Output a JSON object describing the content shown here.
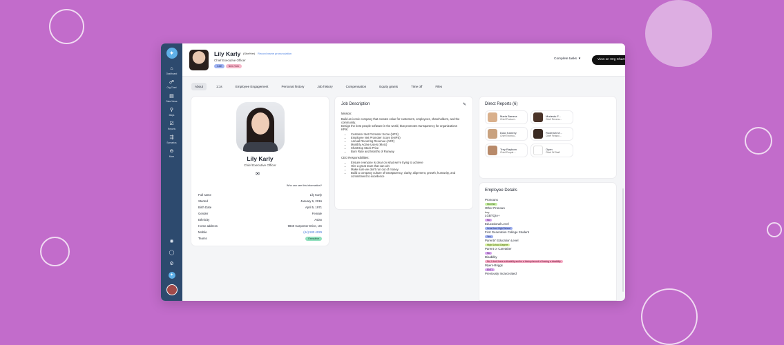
{
  "colors": {
    "background": "#c26ccb",
    "rail": "#2d4a6e",
    "primary_button": "#111111",
    "link": "#3a70d8"
  },
  "rail": {
    "items": [
      {
        "icon": "home-icon",
        "glyph": "⌂",
        "label": "Dashboard"
      },
      {
        "icon": "org-chart-icon",
        "glyph": "☍",
        "label": "Org Chart"
      },
      {
        "icon": "document-icon",
        "glyph": "▤",
        "label": "Data Views"
      },
      {
        "icon": "map-pin-icon",
        "glyph": "⚲",
        "label": "Maps"
      },
      {
        "icon": "reports-icon",
        "glyph": "☑",
        "label": "Reports"
      },
      {
        "icon": "scenarios-icon",
        "glyph": "⇶",
        "label": "Scenarios"
      },
      {
        "icon": "more-icon",
        "glyph": "⊖",
        "label": "More"
      }
    ],
    "bottom_icons": [
      {
        "icon": "settings-sun-icon",
        "glyph": "✺"
      },
      {
        "icon": "chat-icon",
        "glyph": "◯"
      },
      {
        "icon": "gear-icon",
        "glyph": "⚙"
      }
    ]
  },
  "header": {
    "name": "Lily Karly",
    "pronouns": "(She/Her)",
    "record_link": "Record name pronunciation",
    "title": "Chief Executive Officer",
    "chips": [
      "C&E",
      "New York"
    ],
    "complete_tasks": "Complete tasks",
    "org_button": "View on Org Chart"
  },
  "tabs": [
    "About",
    "1:1s",
    "Employee Engagement",
    "Personal history",
    "Job history",
    "Compensation",
    "Equity grants",
    "Time off",
    "Files"
  ],
  "profile": {
    "name": "Lily Karly",
    "title": "Chief Executive Officer",
    "visibility": "Who can see this information?",
    "fields": [
      {
        "label": "Full name",
        "value": "Lily Karly"
      },
      {
        "label": "Started",
        "value": "January 6, 2016"
      },
      {
        "label": "Birth Date",
        "value": "April 5, 1971"
      },
      {
        "label": "Gender",
        "value": "Female"
      },
      {
        "label": "Ethnicity",
        "value": "Asian"
      },
      {
        "label": "Home address",
        "value": "9840 Carpenter Drive, US"
      },
      {
        "label": "Mobile",
        "value": "(44) 500 4029"
      },
      {
        "label": "Teams",
        "value": "Executive"
      }
    ]
  },
  "job_description": {
    "title": "Job Description",
    "mission_label": "Mission:",
    "mission": "Build an iconic company that creates value for customers, employees, shareholders, and the community.",
    "mission2": "Design the best people software in the world, that promotes transparency for organizations",
    "kpis_label": "KPIs:",
    "kpis": [
      "Customer Net Promoter Score (NPS)",
      "Employee Net Promoter Score (eNPS)",
      "Annual Recurring Revenue (ARR)",
      "Monthly Active Users (MAU)",
      "ChartHop Stock Price",
      "Burn Rate and Months of Runway"
    ],
    "ceo_label": "CEO Responsibilities:",
    "ceo": [
      "Ensure everyone is clear on what we're trying to achieve",
      "Hire a great team that can win",
      "Make sure we don't run out of money",
      "Build a company culture of transparency, clarity, alignment, growth, humanity, and commitment to excellence"
    ]
  },
  "direct_reports": {
    "title": "Direct Reports (6)",
    "people": [
      {
        "name": "Maria Barrera",
        "title": "Chief Product...",
        "color": "#d9b08c"
      },
      {
        "name": "Modesto F...",
        "title": "Chief Revenu...",
        "color": "#4a3328"
      },
      {
        "name": "Dulci Kamrey",
        "title": "Chief Technol...",
        "color": "#c9a27f"
      },
      {
        "name": "Roderich M...",
        "title": "Chief Financi...",
        "color": "#3a2a22"
      },
      {
        "name": "Trey Rayborn",
        "title": "Chief People ...",
        "color": "#b88a6a"
      },
      {
        "name": "Open",
        "title": "Chief Of Staff",
        "color": "#ffffff"
      }
    ]
  },
  "employee_details": {
    "title": "Employee Details",
    "items": [
      {
        "label": "Pronouns",
        "chip": "She/Her",
        "style": "lgreen"
      },
      {
        "label": "Other Pronoun",
        "text": "hey"
      },
      {
        "label": "LGBTQIA+",
        "chip": "No",
        "style": "purple"
      },
      {
        "label": "Educational Level",
        "chip": "Less than High School",
        "style": "ind"
      },
      {
        "label": "First Generation College Student",
        "chip": "Yes",
        "style": "ind"
      },
      {
        "label": "Parents' Education Level",
        "chip": "High School Degree",
        "style": "lime"
      },
      {
        "label": "Parent or Caretaker",
        "chip": "No",
        "style": "purple"
      },
      {
        "label": "Disability",
        "chip": "No, I don't have a disability and/or a history/record of having a disability",
        "style": "rose"
      },
      {
        "label": "Myers-Briggs",
        "chip": "ENTJ",
        "style": "purple"
      },
      {
        "label": "Previously Incarcerated",
        "text": ""
      }
    ]
  }
}
